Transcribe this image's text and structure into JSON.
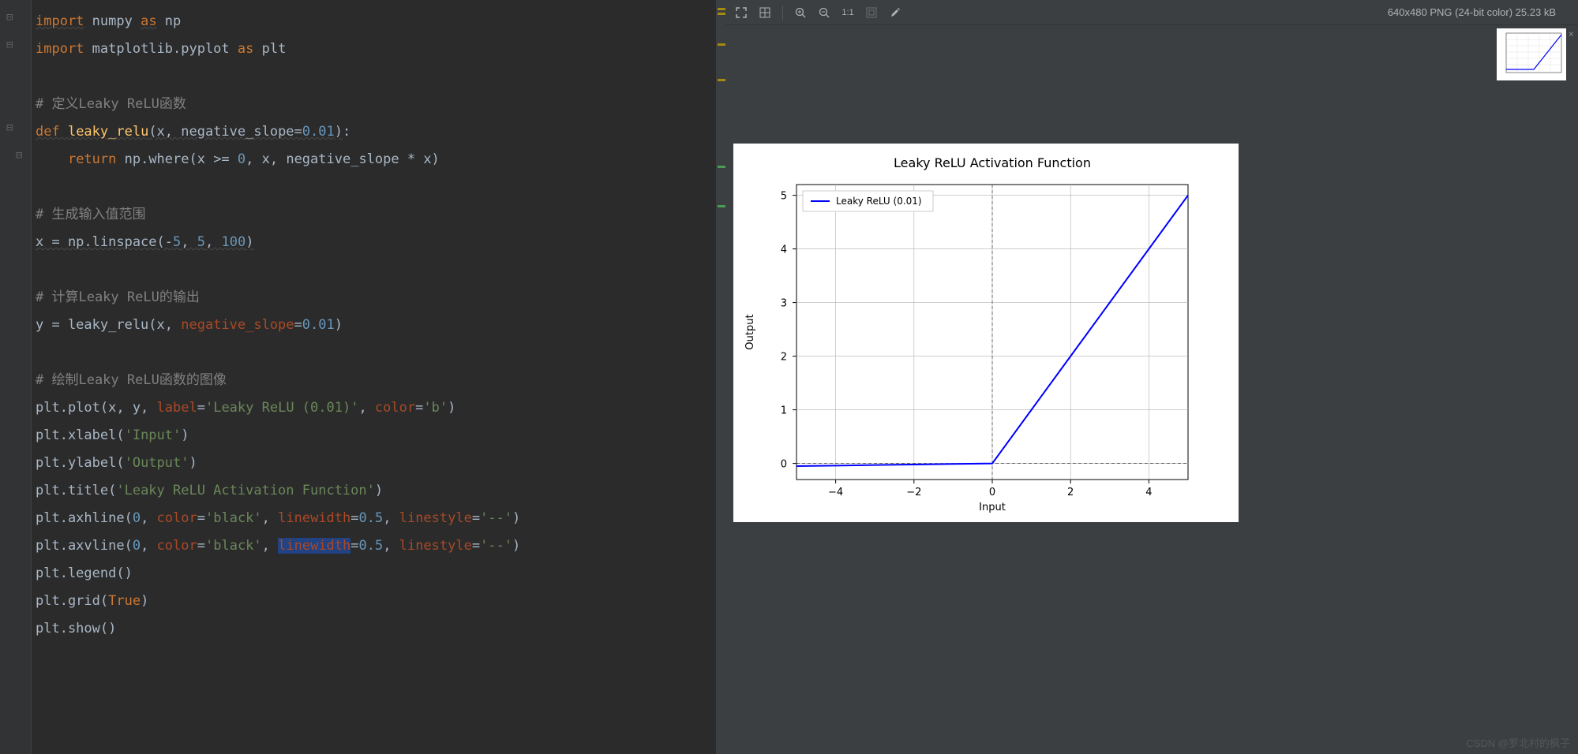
{
  "code": {
    "lines": [
      {
        "tokens": [
          {
            "t": "kw underl",
            "v": "import"
          },
          {
            "t": "",
            "v": " numpy "
          },
          {
            "t": "kw underl",
            "v": "as"
          },
          {
            "t": "",
            "v": " np"
          }
        ]
      },
      {
        "tokens": [
          {
            "t": "kw",
            "v": "import"
          },
          {
            "t": "",
            "v": " matplotlib.pyplot "
          },
          {
            "t": "kw",
            "v": "as"
          },
          {
            "t": "",
            "v": " plt"
          }
        ]
      },
      {
        "tokens": []
      },
      {
        "tokens": [
          {
            "t": "comment",
            "v": "# 定义Leaky ReLU函数"
          }
        ]
      },
      {
        "tokens": [
          {
            "t": "kw underl",
            "v": "def "
          },
          {
            "t": "fn underl",
            "v": "leaky_relu"
          },
          {
            "t": "underl",
            "v": "(x, negative_slope="
          },
          {
            "t": "num underl",
            "v": "0.01"
          },
          {
            "t": "underl",
            "v": ")"
          },
          {
            "t": "",
            "v": ":"
          }
        ]
      },
      {
        "tokens": [
          {
            "t": "",
            "v": "    "
          },
          {
            "t": "kw",
            "v": "return"
          },
          {
            "t": "",
            "v": " np.where(x >= "
          },
          {
            "t": "num",
            "v": "0"
          },
          {
            "t": "",
            "v": ", x, negative_slope * x)"
          }
        ]
      },
      {
        "tokens": []
      },
      {
        "tokens": [
          {
            "t": "comment",
            "v": "# 生成输入值范围"
          }
        ]
      },
      {
        "tokens": [
          {
            "t": "underl",
            "v": "x = np.linspace(-"
          },
          {
            "t": "num underl",
            "v": "5"
          },
          {
            "t": "underl",
            "v": ", "
          },
          {
            "t": "num underl",
            "v": "5"
          },
          {
            "t": "underl",
            "v": ", "
          },
          {
            "t": "num underl",
            "v": "100"
          },
          {
            "t": "underl",
            "v": ")"
          }
        ]
      },
      {
        "tokens": []
      },
      {
        "tokens": [
          {
            "t": "comment",
            "v": "# 计算Leaky ReLU的输出"
          }
        ]
      },
      {
        "tokens": [
          {
            "t": "",
            "v": "y = leaky_relu(x, "
          },
          {
            "t": "param",
            "v": "negative_slope"
          },
          {
            "t": "",
            "v": "="
          },
          {
            "t": "num",
            "v": "0.01"
          },
          {
            "t": "",
            "v": ")"
          }
        ]
      },
      {
        "tokens": []
      },
      {
        "tokens": [
          {
            "t": "comment",
            "v": "# 绘制Leaky ReLU函数的图像"
          }
        ]
      },
      {
        "tokens": [
          {
            "t": "",
            "v": "plt.plot(x, y, "
          },
          {
            "t": "param",
            "v": "label"
          },
          {
            "t": "",
            "v": "="
          },
          {
            "t": "str",
            "v": "'Leaky ReLU (0.01)'"
          },
          {
            "t": "",
            "v": ", "
          },
          {
            "t": "param",
            "v": "color"
          },
          {
            "t": "",
            "v": "="
          },
          {
            "t": "str",
            "v": "'b'"
          },
          {
            "t": "",
            "v": ")"
          }
        ]
      },
      {
        "tokens": [
          {
            "t": "",
            "v": "plt.xlabel("
          },
          {
            "t": "str",
            "v": "'Input'"
          },
          {
            "t": "",
            "v": ")"
          }
        ]
      },
      {
        "tokens": [
          {
            "t": "",
            "v": "plt.ylabel("
          },
          {
            "t": "str",
            "v": "'Output'"
          },
          {
            "t": "",
            "v": ")"
          }
        ]
      },
      {
        "tokens": [
          {
            "t": "",
            "v": "plt.title("
          },
          {
            "t": "str",
            "v": "'Leaky ReLU Activation Function'"
          },
          {
            "t": "",
            "v": ")"
          }
        ]
      },
      {
        "tokens": [
          {
            "t": "",
            "v": "plt.axhline("
          },
          {
            "t": "num",
            "v": "0"
          },
          {
            "t": "",
            "v": ", "
          },
          {
            "t": "param",
            "v": "color"
          },
          {
            "t": "",
            "v": "="
          },
          {
            "t": "str",
            "v": "'black'"
          },
          {
            "t": "",
            "v": ", "
          },
          {
            "t": "param",
            "v": "linewidth"
          },
          {
            "t": "",
            "v": "="
          },
          {
            "t": "num",
            "v": "0.5"
          },
          {
            "t": "",
            "v": ", "
          },
          {
            "t": "param",
            "v": "linestyle"
          },
          {
            "t": "",
            "v": "="
          },
          {
            "t": "str",
            "v": "'--'"
          },
          {
            "t": "",
            "v": ")"
          }
        ]
      },
      {
        "tokens": [
          {
            "t": "",
            "v": "plt.axvline("
          },
          {
            "t": "num",
            "v": "0"
          },
          {
            "t": "",
            "v": ", "
          },
          {
            "t": "param",
            "v": "color"
          },
          {
            "t": "",
            "v": "="
          },
          {
            "t": "str",
            "v": "'black'"
          },
          {
            "t": "",
            "v": ", "
          },
          {
            "t": "param highlight-word",
            "v": "linewidth"
          },
          {
            "t": "",
            "v": "="
          },
          {
            "t": "num",
            "v": "0.5"
          },
          {
            "t": "",
            "v": ", "
          },
          {
            "t": "param",
            "v": "linestyle"
          },
          {
            "t": "",
            "v": "="
          },
          {
            "t": "str",
            "v": "'--'"
          },
          {
            "t": "",
            "v": ")"
          }
        ]
      },
      {
        "tokens": [
          {
            "t": "",
            "v": "plt.legend()"
          }
        ]
      },
      {
        "tokens": [
          {
            "t": "",
            "v": "plt.grid("
          },
          {
            "t": "kw",
            "v": "True"
          },
          {
            "t": "",
            "v": ")"
          }
        ]
      },
      {
        "tokens": [
          {
            "t": "",
            "v": "plt.show()"
          }
        ]
      }
    ]
  },
  "toolbar": {
    "ratio": "1:1",
    "info": "640x480 PNG (24-bit color) 25.23 kB"
  },
  "chart_data": {
    "type": "line",
    "title": "Leaky ReLU Activation Function",
    "xlabel": "Input",
    "ylabel": "Output",
    "xlim": [
      -5,
      5
    ],
    "ylim": [
      -0.3,
      5.2
    ],
    "xticks": [
      -4,
      -2,
      0,
      2,
      4
    ],
    "yticks": [
      0,
      1,
      2,
      3,
      4,
      5
    ],
    "series": [
      {
        "name": "Leaky ReLU (0.01)",
        "color": "#0000ff",
        "x": [
          -5,
          -4,
          -3,
          -2,
          -1,
          0,
          1,
          2,
          3,
          4,
          5
        ],
        "y": [
          -0.05,
          -0.04,
          -0.03,
          -0.02,
          -0.01,
          0,
          1,
          2,
          3,
          4,
          5
        ]
      }
    ],
    "legend_position": "upper-left",
    "grid": true
  },
  "watermark": "CSDN @罗北村的枫子"
}
